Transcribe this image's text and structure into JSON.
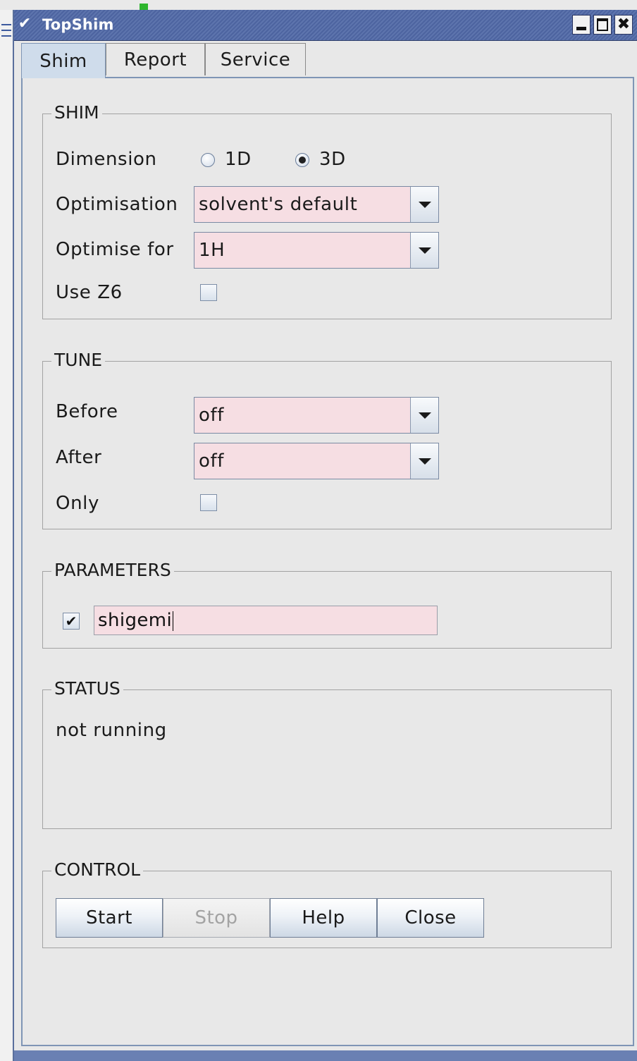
{
  "window": {
    "title": "TopShim",
    "menu_icon": "chevron-down-icon",
    "minimize_icon": "minimize-icon",
    "maximize_icon": "maximize-icon",
    "close_icon": "close-icon"
  },
  "tabs": [
    {
      "label": "Shim",
      "active": true
    },
    {
      "label": "Report",
      "active": false
    },
    {
      "label": "Service",
      "active": false
    }
  ],
  "shim": {
    "title": "SHIM",
    "dimension_label": "Dimension",
    "dimension_options": [
      {
        "label": "1D",
        "selected": false
      },
      {
        "label": "3D",
        "selected": true
      }
    ],
    "optimisation_label": "Optimisation",
    "optimisation_value": "solvent's default",
    "optimise_for_label": "Optimise for",
    "optimise_for_value": "1H",
    "use_z6_label": "Use Z6",
    "use_z6_checked": false
  },
  "tune": {
    "title": "TUNE",
    "before_label": "Before",
    "before_value": "off",
    "after_label": "After",
    "after_value": "off",
    "only_label": "Only",
    "only_checked": false
  },
  "parameters": {
    "title": "PARAMETERS",
    "enabled": true,
    "value": "shigemi"
  },
  "status": {
    "title": "STATUS",
    "text": "not running"
  },
  "control": {
    "title": "CONTROL",
    "start_label": "Start",
    "stop_label": "Stop",
    "help_label": "Help",
    "close_label": "Close",
    "stop_enabled": false
  },
  "colors": {
    "titlebar": "#5d74ad",
    "field_background": "#f6dee3",
    "panel_border": "#7f95b5",
    "panel_background": "#e8e8e8"
  }
}
